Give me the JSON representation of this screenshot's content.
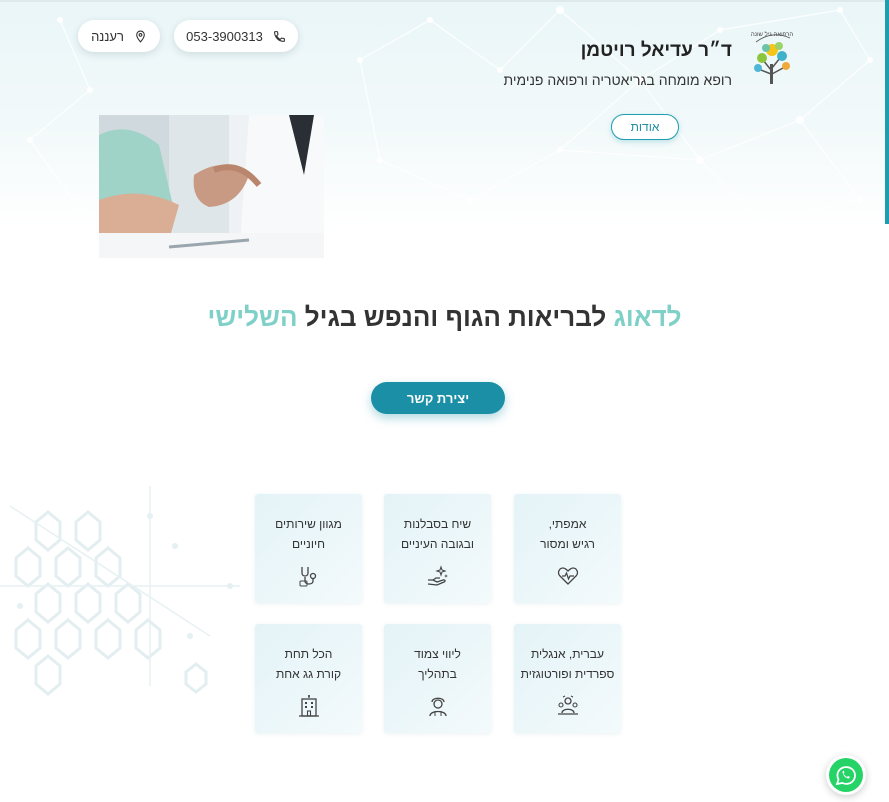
{
  "header": {
    "doctor_name": "ד״ר עדיאל רויטמן",
    "subtitle": "רופא מומחה בגריאטריה ורפואה פנימית",
    "about_label": "אודות",
    "phone": "053-3900313",
    "city": "רעננה",
    "logo_text": "הרפואה גיל שונה"
  },
  "hero": {
    "headline_accent_1": "לדאוג",
    "headline_main": " לבריאות הגוף והנפש בגיל ",
    "headline_accent_2": "השלישי",
    "contact_label": "יצירת קשר"
  },
  "features": [
    {
      "text": "אמפתי,\nרגיש ומסור",
      "icon": "heart-icon"
    },
    {
      "text": "שיח בסבלנות\nובגובה העיניים",
      "icon": "hand-sparkle-icon"
    },
    {
      "text": "מגוון שירותים\nחיוניים",
      "icon": "stethoscope-icon"
    },
    {
      "text": "עברית, אנגלית\nספרדית ופורטוגזית",
      "icon": "languages-icon"
    },
    {
      "text": "ליווי צמוד\nבתהליך",
      "icon": "doctor-icon"
    },
    {
      "text": "הכל תחת\nקורת גג אחת",
      "icon": "building-icon"
    }
  ],
  "colors": {
    "accent": "#1a8fa6",
    "accent_light": "#7fd0c7",
    "whatsapp": "#25d366"
  }
}
